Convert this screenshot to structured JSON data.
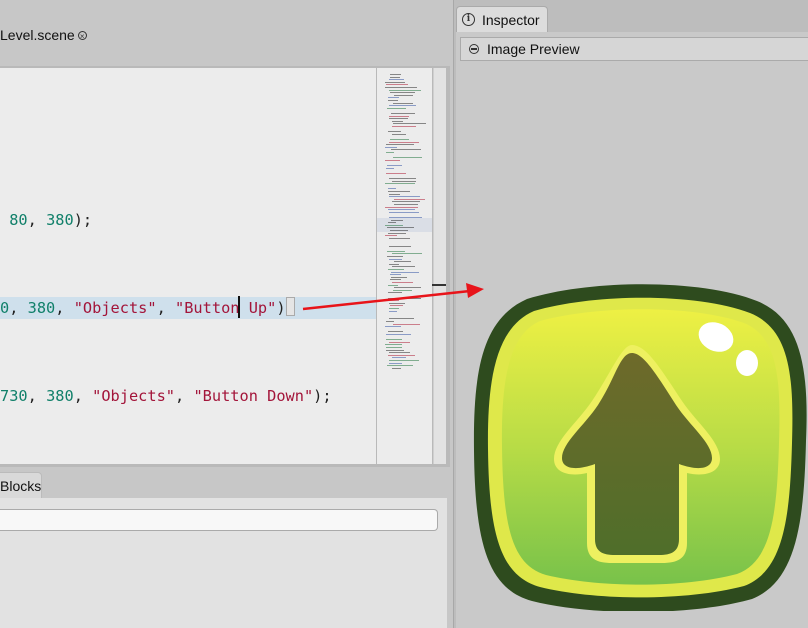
{
  "editor": {
    "scene_tab_label": "Level.scene",
    "scene_tab_close": "×",
    "code_lines": [
      {
        "pieces": [
          {
            "t": " ",
            "c": "p"
          },
          {
            "t": "80",
            "c": "num"
          },
          {
            "t": ", ",
            "c": "p"
          },
          {
            "t": "380",
            "c": "num"
          },
          {
            "t": ");",
            "c": "p"
          }
        ]
      },
      {
        "pieces": [
          {
            "t": "0",
            "c": "num"
          },
          {
            "t": ", ",
            "c": "p"
          },
          {
            "t": "380",
            "c": "num"
          },
          {
            "t": ", ",
            "c": "p"
          },
          {
            "t": "\"Objects\"",
            "c": "str"
          },
          {
            "t": ", ",
            "c": "p"
          },
          {
            "t": "\"Button Up\"",
            "c": "str"
          },
          {
            "t": ");",
            "c": "p"
          }
        ],
        "highlighted": true
      },
      {
        "pieces": [
          {
            "t": "730",
            "c": "num"
          },
          {
            "t": ", ",
            "c": "p"
          },
          {
            "t": "380",
            "c": "num"
          },
          {
            "t": ", ",
            "c": "p"
          },
          {
            "t": "\"Objects\"",
            "c": "str"
          },
          {
            "t": ", ",
            "c": "p"
          },
          {
            "t": "\"Button Down\"",
            "c": "str"
          },
          {
            "t": ");",
            "c": "p"
          }
        ]
      }
    ],
    "blocks_tab_label": "Blocks",
    "blocks_search_value": ""
  },
  "inspector": {
    "tab_label": "Inspector",
    "tab_icon": "info-icon",
    "section_title": "Image Preview",
    "section_icon": "collapse-icon",
    "preview_image": "button-up-icon"
  },
  "colors": {
    "number": "#11806a",
    "string": "#a3153a",
    "highlight": "#cfe0ec",
    "link_arrow": "#e8141a",
    "button_outline": "#2e4b1e",
    "button_top": "#e6ea3e",
    "button_bottom": "#7cc24a",
    "arrow_fill": "#5d6a2c"
  }
}
